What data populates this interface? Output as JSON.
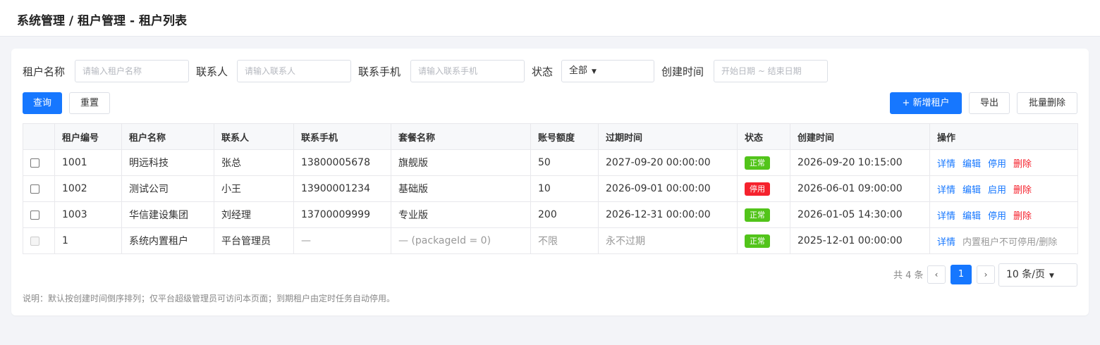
{
  "header": {
    "title": "系统管理 / 租户管理 - 租户列表"
  },
  "filters": {
    "tenant_name": {
      "label": "租户名称",
      "placeholder": "请输入租户名称"
    },
    "contact": {
      "label": "联系人",
      "placeholder": "请输入联系人"
    },
    "phone": {
      "label": "联系手机",
      "placeholder": "请输入联系手机"
    },
    "status": {
      "label": "状态",
      "value": "全部"
    },
    "created": {
      "label": "创建时间",
      "placeholder": "开始日期 ~ 结束日期"
    }
  },
  "actions": {
    "query": "查询",
    "reset": "重置",
    "add": "+ 新增租户",
    "export": "导出",
    "batch_delete": "批量删除"
  },
  "table": {
    "columns": [
      "租户编号",
      "租户名称",
      "联系人",
      "联系手机",
      "套餐名称",
      "账号额度",
      "过期时间",
      "状态",
      "创建时间",
      "操作"
    ],
    "rows": [
      {
        "id": "1001",
        "name": "明远科技",
        "contact": "张总",
        "phone": "13800005678",
        "package": "旗舰版",
        "quota": "50",
        "expire": "2027-09-20 00:00:00",
        "status": "正常",
        "created": "2026-09-20 10:15:00",
        "op_detail": "详情",
        "op_edit": "编辑",
        "op_toggle": "停用",
        "op_delete": "删除"
      },
      {
        "id": "1002",
        "name": "测试公司",
        "contact": "小王",
        "phone": "13900001234",
        "package": "基础版",
        "quota": "10",
        "expire": "2026-09-01 00:00:00",
        "status": "停用",
        "created": "2026-06-01 09:00:00",
        "op_detail": "详情",
        "op_edit": "编辑",
        "op_toggle": "启用",
        "op_delete": "删除"
      },
      {
        "id": "1003",
        "name": "华信建设集团",
        "contact": "刘经理",
        "phone": "13700009999",
        "package": "专业版",
        "quota": "200",
        "expire": "2026-12-31 00:00:00",
        "status": "正常",
        "created": "2026-01-05 14:30:00",
        "op_detail": "详情",
        "op_edit": "编辑",
        "op_toggle": "停用",
        "op_delete": "删除"
      },
      {
        "id": "1",
        "name": "系统内置租户",
        "contact": "平台管理员",
        "phone": "—",
        "package": "— (packageId = 0)",
        "quota": "不限",
        "expire": "永不过期",
        "status": "正常",
        "created": "2025-12-01 00:00:00",
        "op_detail": "详情",
        "op_note": "内置租户不可停用/删除"
      }
    ]
  },
  "colors": {
    "primary": "#1677ff",
    "status_ok": "#52c41a",
    "status_stop": "#f5222d"
  },
  "pagination": {
    "total": "共 4 条",
    "prev": "‹",
    "page": "1",
    "next": "›",
    "page_size": "10 条/页"
  },
  "footer_note": "说明：默认按创建时间倒序排列；仅平台超级管理员可访问本页面；到期租户由定时任务自动停用。"
}
